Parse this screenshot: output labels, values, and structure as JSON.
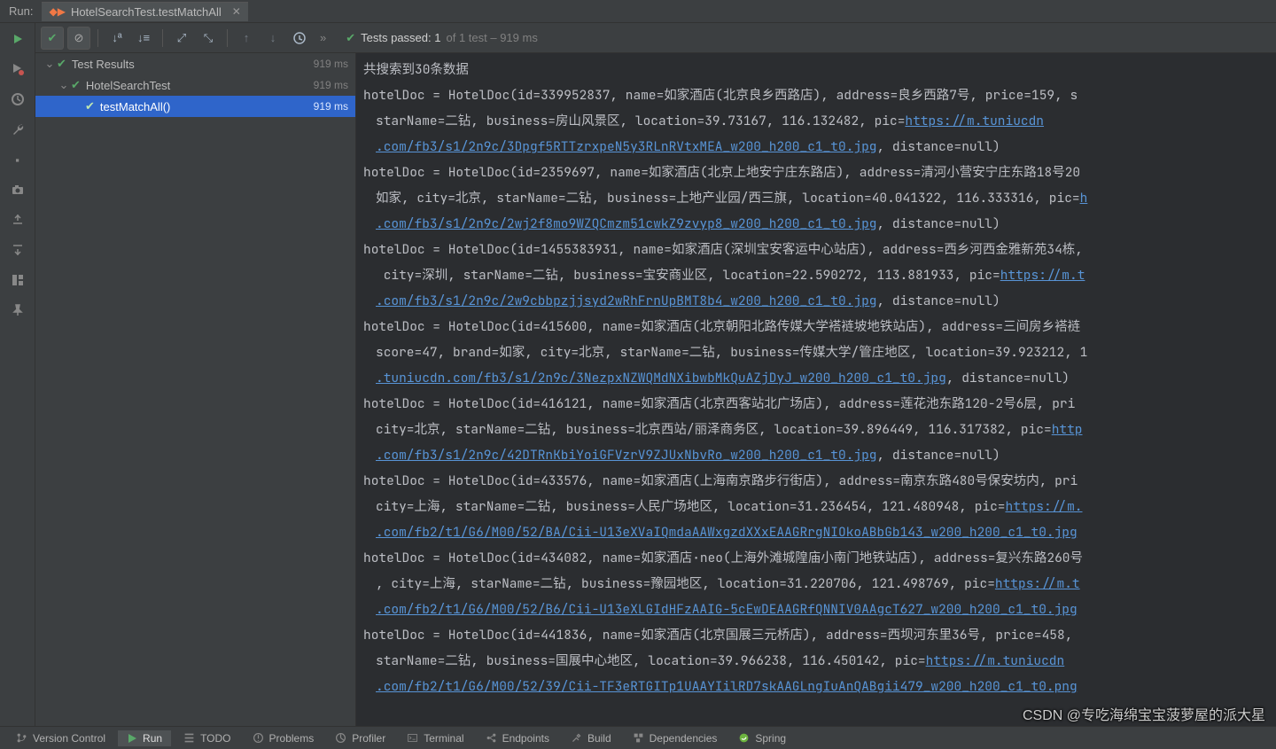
{
  "header": {
    "run_label": "Run:",
    "tab_title": "HotelSearchTest.testMatchAll"
  },
  "toolbar": {
    "status_prefix": "Tests passed:",
    "passed": "1",
    "of_text": "of 1 test – 919 ms"
  },
  "tree": {
    "root": {
      "label": "Test Results",
      "time": "919 ms"
    },
    "class": {
      "label": "HotelSearchTest",
      "time": "919 ms"
    },
    "method": {
      "label": "testMatchAll()",
      "time": "919 ms"
    }
  },
  "console_lines": [
    {
      "t": "共搜索到30条数据"
    },
    {
      "t": "hotelDoc = HotelDoc(id=339952837, name=如家酒店(北京良乡西路店), address=良乡西路7号, price=159, s"
    },
    {
      "cont": true,
      "pre": "starName=二钻, business=房山风景区, location=39.73167, 116.132482, pic=",
      "link": "https://m.tuniucdn"
    },
    {
      "cont": true,
      "link": ".com/fb3/s1/2n9c/3Dpgf5RTTzrxpeN5y3RLnRVtxMEA_w200_h200_c1_t0.jpg",
      "post": ", distance=null)"
    },
    {
      "t": "hotelDoc = HotelDoc(id=2359697, name=如家酒店(北京上地安宁庄东路店), address=清河小营安宁庄东路18号20"
    },
    {
      "cont": true,
      "pre": "如家, city=北京, starName=二钻, business=上地产业园/西三旗, location=40.041322, 116.333316, pic=",
      "link": "h"
    },
    {
      "cont": true,
      "link": ".com/fb3/s1/2n9c/2wj2f8mo9WZQCmzm51cwkZ9zvyp8_w200_h200_c1_t0.jpg",
      "post": ", distance=null)"
    },
    {
      "t": "hotelDoc = HotelDoc(id=1455383931, name=如家酒店(深圳宝安客运中心站店), address=西乡河西金雅新苑34栋,"
    },
    {
      "cont": true,
      "pre": " city=深圳, starName=二钻, business=宝安商业区, location=22.590272, 113.881933, pic=",
      "link": "https://m.t"
    },
    {
      "cont": true,
      "link": ".com/fb3/s1/2n9c/2w9cbbpzjjsyd2wRhFrnUpBMT8b4_w200_h200_c1_t0.jpg",
      "post": ", distance=null)"
    },
    {
      "t": "hotelDoc = HotelDoc(id=415600, name=如家酒店(北京朝阳北路传媒大学褡裢坡地铁站店), address=三间房乡褡裢"
    },
    {
      "cont": true,
      "t": "score=47, brand=如家, city=北京, starName=二钻, business=传媒大学/管庄地区, location=39.923212, 1"
    },
    {
      "cont": true,
      "link": ".tuniucdn.com/fb3/s1/2n9c/3NezpxNZWQMdNXibwbMkQuAZjDyJ_w200_h200_c1_t0.jpg",
      "post": ", distance=null)"
    },
    {
      "t": "hotelDoc = HotelDoc(id=416121, name=如家酒店(北京西客站北广场店), address=莲花池东路120-2号6层, pri"
    },
    {
      "cont": true,
      "pre": "city=北京, starName=二钻, business=北京西站/丽泽商务区, location=39.896449, 116.317382, pic=",
      "link": "http"
    },
    {
      "cont": true,
      "link": ".com/fb3/s1/2n9c/42DTRnKbiYoiGFVzrV9ZJUxNbvRo_w200_h200_c1_t0.jpg",
      "post": ", distance=null)"
    },
    {
      "t": "hotelDoc = HotelDoc(id=433576, name=如家酒店(上海南京路步行街店), address=南京东路480号保安坊内, pri"
    },
    {
      "cont": true,
      "pre": "city=上海, starName=二钻, business=人民广场地区, location=31.236454, 121.480948, pic=",
      "link": "https://m."
    },
    {
      "cont": true,
      "link": ".com/fb2/t1/G6/M00/52/BA/Cii-U13eXVaIQmdaAAWxgzdXXxEAAGRrgNIOkoABbGb143_w200_h200_c1_t0.jpg"
    },
    {
      "t": "hotelDoc = HotelDoc(id=434082, name=如家酒店·neo(上海外滩城隍庙小南门地铁站店), address=复兴东路260号"
    },
    {
      "cont": true,
      "pre": ", city=上海, starName=二钻, business=豫园地区, location=31.220706, 121.498769, pic=",
      "link": "https://m.t"
    },
    {
      "cont": true,
      "link": ".com/fb2/t1/G6/M00/52/B6/Cii-U13eXLGIdHFzAAIG-5cEwDEAAGRfQNNIV0AAgcT627_w200_h200_c1_t0.jpg"
    },
    {
      "t": "hotelDoc = HotelDoc(id=441836, name=如家酒店(北京国展三元桥店), address=西坝河东里36号, price=458, "
    },
    {
      "cont": true,
      "pre": "starName=二钻, business=国展中心地区, location=39.966238, 116.450142, pic=",
      "link": "https://m.tuniucdn"
    },
    {
      "cont": true,
      "link": ".com/fb2/t1/G6/M00/52/39/Cii-TF3eRTGITp1UAAYIilRD7skAAGLngIuAnQABgii479_w200_h200_c1_t0.png"
    }
  ],
  "bottom": {
    "items": [
      {
        "icon": "branch",
        "label": "Version Control"
      },
      {
        "icon": "run",
        "label": "Run",
        "active": true
      },
      {
        "icon": "todo",
        "label": "TODO"
      },
      {
        "icon": "warn",
        "label": "Problems"
      },
      {
        "icon": "profiler",
        "label": "Profiler"
      },
      {
        "icon": "terminal",
        "label": "Terminal"
      },
      {
        "icon": "endpoints",
        "label": "Endpoints"
      },
      {
        "icon": "build",
        "label": "Build"
      },
      {
        "icon": "deps",
        "label": "Dependencies"
      },
      {
        "icon": "spring",
        "label": "Spring"
      }
    ]
  },
  "watermark": "CSDN @专吃海绵宝宝菠萝屋的派大星"
}
